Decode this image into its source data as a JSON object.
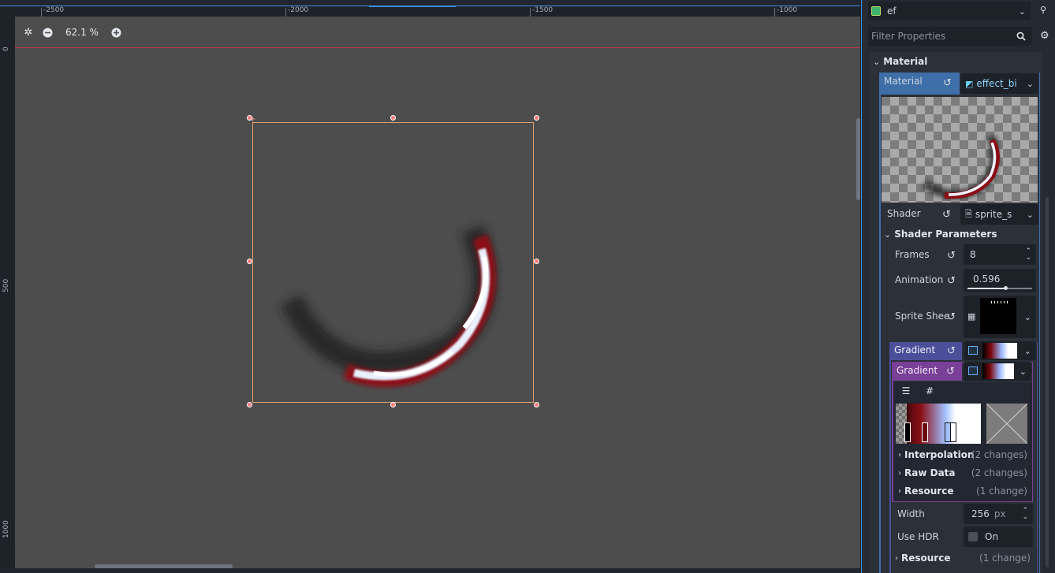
{
  "canvas": {
    "ruler_labels_h": [
      "-2500",
      "-2000",
      "-1500",
      "-1000"
    ],
    "ruler_labels_v": [
      "0",
      "500",
      "1000"
    ],
    "zoom_level": "62.1 %"
  },
  "inspector": {
    "object_name": "ef",
    "filter_placeholder": "Filter Properties",
    "section_material": "Material",
    "material_label": "Material",
    "material_value": "effect_bi",
    "shader_label": "Shader",
    "shader_value": "sprite_s",
    "shader_params_label": "Shader Parameters",
    "frames_label": "Frames",
    "frames_value": "8",
    "animation_label": "Animation",
    "animation_value": "0.596",
    "animation_fraction": 0.596,
    "sprite_sheet_label": "Sprite Shee",
    "gradient_outer_label": "Gradient",
    "gradient_inner_label": "Gradient",
    "interpolation_label": "Interpolation",
    "interpolation_changes": "(2 changes)",
    "raw_data_label": "Raw Data",
    "raw_data_changes": "(2 changes)",
    "resource_inner_label": "Resource",
    "resource_inner_changes": "(1 change)",
    "width_label": "Width",
    "width_value": "256",
    "width_unit": "px",
    "use_hdr_label": "Use HDR",
    "use_hdr_value": "On",
    "resource_outer_label": "Resource",
    "resource_outer_changes": "(1 change)"
  },
  "colors": {
    "material_accent": "#3f6fa8",
    "gradient_outer_accent": "#4b4f9a",
    "gradient_inner_accent": "#7a3f97",
    "selection_rect": "#e3a071",
    "handle": "#ff7a7a"
  }
}
